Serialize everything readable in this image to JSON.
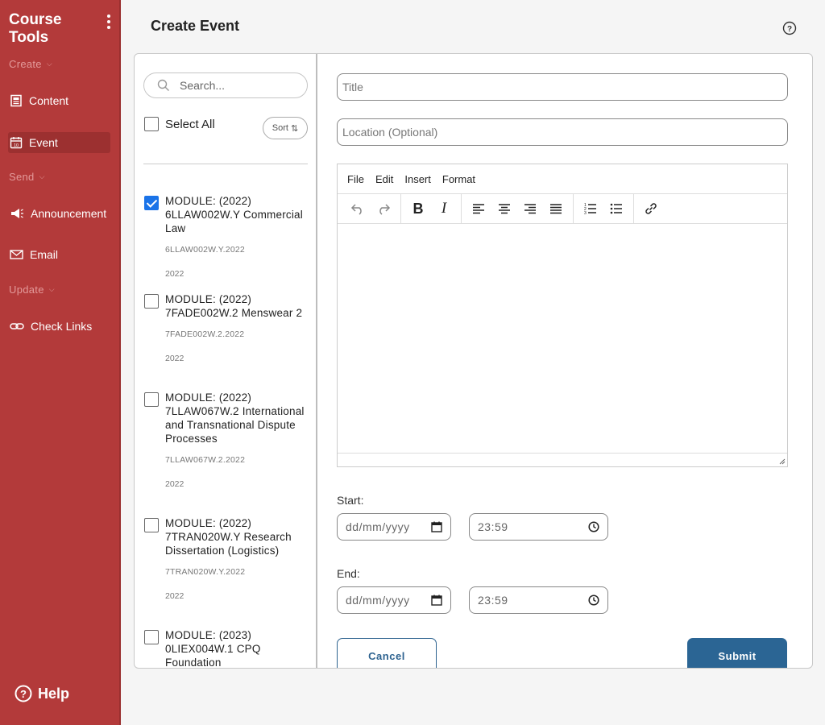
{
  "sidebar": {
    "brand": "Course Tools",
    "sections": {
      "create": "Create",
      "send": "Send",
      "update": "Update"
    },
    "items": {
      "content": "Content",
      "event": "Event",
      "announcement": "Announcement",
      "email": "Email",
      "check_links": "Check Links"
    },
    "help": "Help"
  },
  "header": {
    "title": "Create Event"
  },
  "list": {
    "search_placeholder": "Search...",
    "select_all": "Select All",
    "sort": "Sort",
    "modules": [
      {
        "title": "MODULE: (2022) 6LLAW002W.Y Commercial Law",
        "code": "6LLAW002W.Y.2022",
        "year": "2022",
        "checked": true
      },
      {
        "title": "MODULE: (2022) 7FADE002W.2 Menswear 2",
        "code": "7FADE002W.2.2022",
        "year": "2022",
        "checked": false
      },
      {
        "title": "MODULE: (2022) 7LLAW067W.2 International and Transnational Dispute Processes",
        "code": "7LLAW067W.2.2022",
        "year": "2022",
        "checked": false
      },
      {
        "title": "MODULE: (2022) 7TRAN020W.Y Research Dissertation (Logistics)",
        "code": "7TRAN020W.Y.2022",
        "year": "2022",
        "checked": false
      },
      {
        "title": "MODULE: (2023) 0LIEX004W.1 CPQ Foundation",
        "code": "",
        "year": "",
        "checked": false
      }
    ]
  },
  "form": {
    "title_placeholder": "Title",
    "location_placeholder": "Location (Optional)",
    "editor_menu": [
      "File",
      "Edit",
      "Insert",
      "Format"
    ],
    "start_label": "Start:",
    "end_label": "End:",
    "date_placeholder": "dd/mm/yyyy",
    "start_time": "23:59",
    "end_time": "23:59",
    "cancel": "Cancel",
    "submit": "Submit"
  }
}
